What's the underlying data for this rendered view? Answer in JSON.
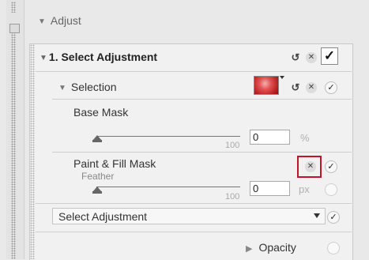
{
  "header": {
    "title": "Adjust"
  },
  "step": {
    "title": "1. Select Adjustment"
  },
  "selection": {
    "label": "Selection",
    "swatch_color": "#e04848"
  },
  "base_mask": {
    "label": "Base Mask",
    "slider_max_label": "100",
    "value": "0",
    "unit": "%"
  },
  "paint_fill": {
    "label": "Paint & Fill Mask",
    "sub_label": "Feather",
    "slider_max_label": "100",
    "value": "0",
    "unit": "px"
  },
  "select_adjustment": {
    "selected": "Select Adjustment"
  },
  "opacity": {
    "label": "Opacity"
  },
  "colors": {
    "highlight": "#c3122b"
  }
}
